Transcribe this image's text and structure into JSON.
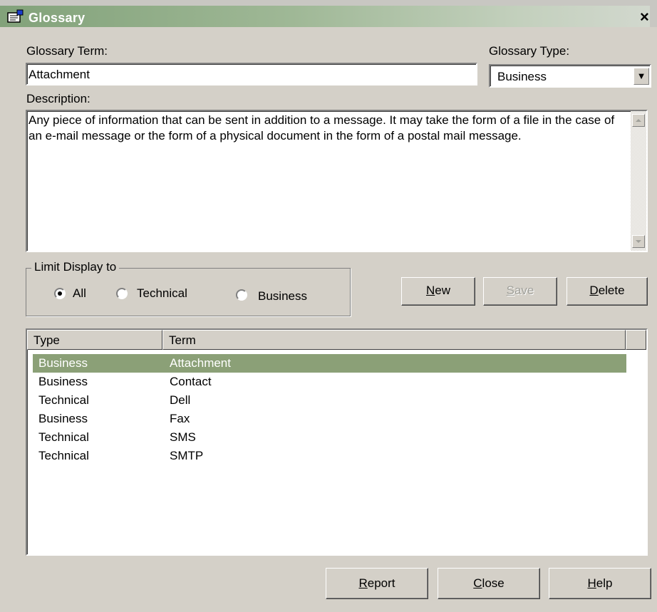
{
  "window": {
    "title": "Glossary",
    "close_glyph": "×",
    "icon": "glossary-window-icon"
  },
  "glossary_term": {
    "label": "Glossary Term:",
    "value": "Attachment"
  },
  "glossary_type": {
    "label": "Glossary Type:",
    "value": "Business",
    "arrow": "▼"
  },
  "description": {
    "label": "Description:",
    "value": "Any piece of information that can be sent in addition to a message. It may take the form of a file in the case of an e-mail message or the form of a physical document in the form of a postal mail message."
  },
  "limit_display": {
    "label": "Limit Display to",
    "options": [
      {
        "label": "All",
        "checked": true
      },
      {
        "label": "Technical",
        "checked": false
      },
      {
        "label": "Business",
        "checked": false
      }
    ]
  },
  "actions": {
    "new": {
      "mnemonic": "N",
      "rest": "ew"
    },
    "save": {
      "mnemonic": "S",
      "rest": "ave",
      "disabled": true
    },
    "delete": {
      "mnemonic": "D",
      "rest": "elete"
    }
  },
  "list": {
    "columns": [
      "Type",
      "Term"
    ],
    "rows": [
      {
        "type": "Business",
        "term": "Attachment",
        "selected": true
      },
      {
        "type": "Business",
        "term": "Contact"
      },
      {
        "type": "Technical",
        "term": "Dell"
      },
      {
        "type": "Business",
        "term": "Fax"
      },
      {
        "type": "Technical",
        "term": "SMS"
      },
      {
        "type": "Technical",
        "term": "SMTP"
      }
    ]
  },
  "footer": {
    "report": {
      "mnemonic": "R",
      "rest": "eport"
    },
    "close": {
      "mnemonic": "C",
      "rest": "lose"
    },
    "help": {
      "mnemonic": "H",
      "rest": "elp"
    }
  },
  "colors": {
    "selection": "#8ba077",
    "title_bar": "#82a27a",
    "face": "#d4d0c8"
  }
}
